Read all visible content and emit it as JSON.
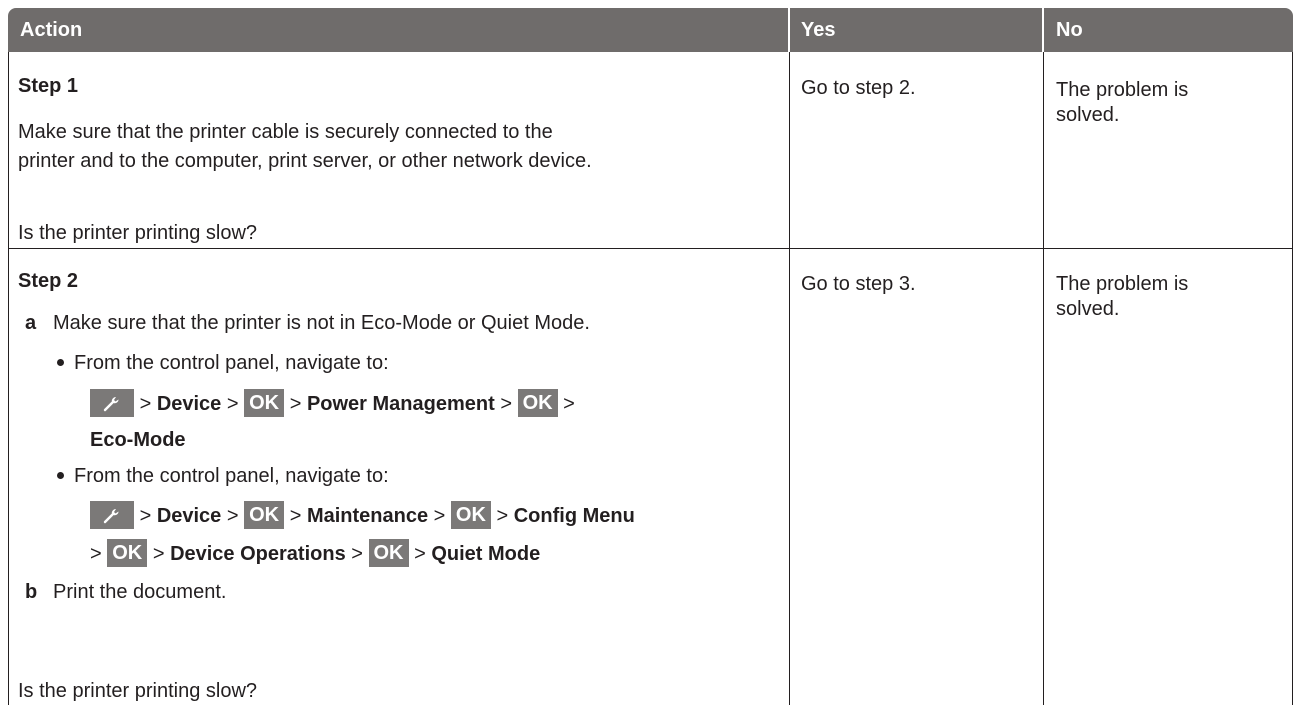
{
  "table": {
    "headers": {
      "action": "Action",
      "yes": "Yes",
      "no": "No"
    },
    "step1": {
      "title": "Step 1",
      "line1": "Make sure that the printer cable is securely connected to the",
      "line2": "printer and to the computer, print server, or other network device.",
      "question": "Is the printer printing slow?",
      "yes": "Go to step 2.",
      "no_line1": "The problem is",
      "no_line2": "solved."
    },
    "step2": {
      "title": "Step 2",
      "a_label": "a",
      "a_text": "Make sure that the printer is not in Eco-Mode or Quiet Mode.",
      "bullet1": "From the control panel, navigate to:",
      "path1": {
        "sep": ">",
        "device": "Device",
        "ok": "OK",
        "power": "Power Management",
        "eco": "Eco-Mode"
      },
      "bullet2": "From the control panel, navigate to:",
      "path2": {
        "sep": ">",
        "device": "Device",
        "ok": "OK",
        "maintenance": "Maintenance",
        "config": "Config Menu",
        "device_ops": "Device Operations",
        "quiet": "Quiet Mode"
      },
      "b_label": "b",
      "b_text": "Print the document.",
      "question": "Is the printer printing slow?",
      "yes": "Go to step 3.",
      "no_line1": "The problem is",
      "no_line2": "solved."
    }
  },
  "icons": {
    "wrench": "wrench-icon"
  },
  "colors": {
    "header_bg": "#6f6c6b",
    "key_bg": "#7b7978",
    "text": "#231f20"
  }
}
